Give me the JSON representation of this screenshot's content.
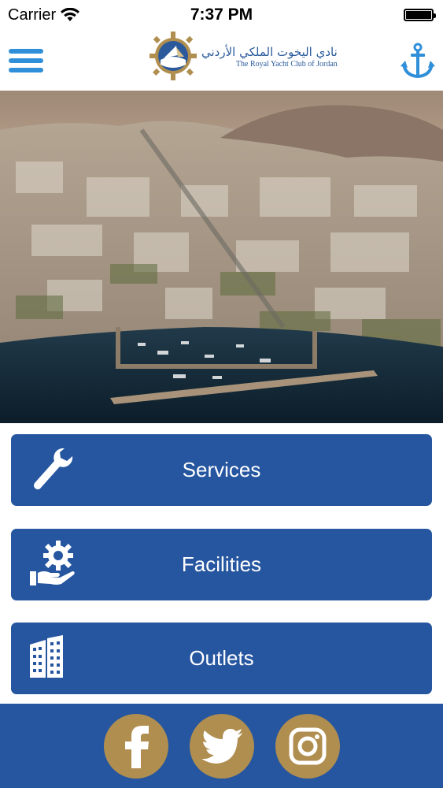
{
  "status": {
    "carrier": "Carrier",
    "time": "7:37 PM"
  },
  "header": {
    "logo_arabic": "نادي اليخوت الملكي الأردني",
    "logo_english": "The Royal Yacht Club of Jordan",
    "menu_icon": "hamburger-icon",
    "right_icon": "anchor-icon"
  },
  "buttons": [
    {
      "label": "Services",
      "icon": "wrench-icon"
    },
    {
      "label": "Facilities",
      "icon": "gear-hand-icon"
    },
    {
      "label": "Outlets",
      "icon": "building-icon"
    }
  ],
  "social": [
    {
      "name": "facebook",
      "icon": "facebook-icon"
    },
    {
      "name": "twitter",
      "icon": "twitter-icon"
    },
    {
      "name": "instagram",
      "icon": "instagram-icon"
    }
  ],
  "colors": {
    "primary_blue": "#2656a0",
    "gold": "#b08e4f",
    "icon_blue": "#2f8fd8"
  }
}
